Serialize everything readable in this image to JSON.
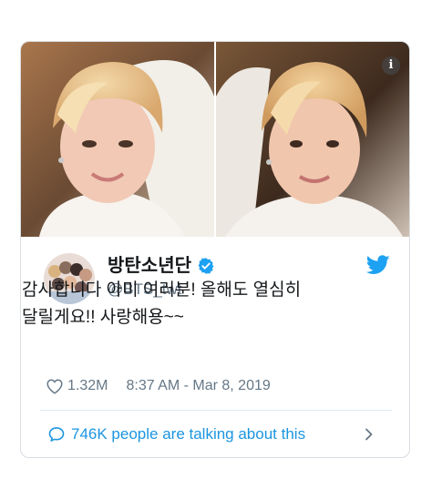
{
  "tweet": {
    "display_name": "방탄소년단",
    "handle": "@BTS_twt",
    "text": "감사합니다 아미 여러분! 올해도 열심히 달릴게요!! 사랑해용~~",
    "likes": "1.32M",
    "timestamp": "8:37 AM - Mar 8, 2019",
    "conversation_text": "746K people are talking about this",
    "verified": true
  },
  "media": {
    "photo_count": 2,
    "info_icon_glyph": "i"
  },
  "icons": {
    "info": "info-icon",
    "verified": "verified-badge-icon",
    "twitter": "twitter-bird-icon",
    "heart": "heart-icon",
    "conversation": "speech-bubble-icon",
    "chevron": "chevron-right-icon"
  },
  "colors": {
    "twitter_blue": "#1da1f2",
    "link_blue": "#1b95e0",
    "secondary_text": "#657786",
    "primary_text": "#14171a",
    "border": "#d8dde2"
  }
}
